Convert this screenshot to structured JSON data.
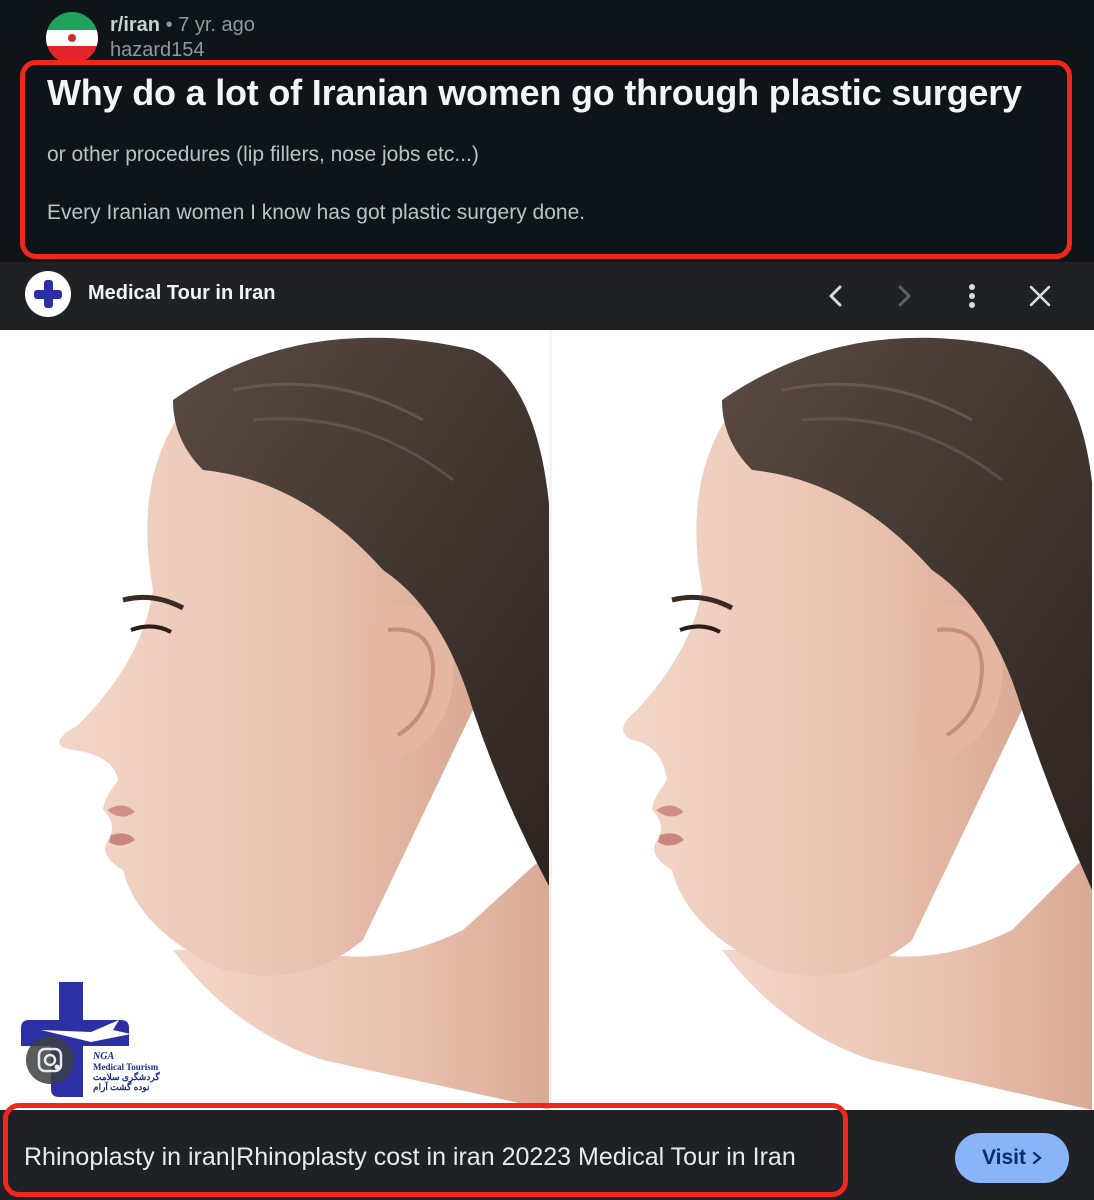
{
  "post": {
    "subreddit": "r/iran",
    "age": "7 yr. ago",
    "separator": "•",
    "author": "hazard154",
    "title": "Why do a lot of Iranian women go through plastic surgery",
    "body_lines": [
      "or other procedures (lip fillers, nose jobs etc...)",
      "Every Iranian women I know has got plastic surgery done."
    ]
  },
  "ad": {
    "advertiser": "Medical Tour in Iran",
    "icons": [
      "previous-icon",
      "next-icon",
      "more-vert-icon",
      "close-icon"
    ],
    "image": {
      "panels": [
        "before",
        "after"
      ],
      "logo_text": [
        "NGA",
        "Medical Tourism",
        "گردشگری سلامت",
        "نوده گشت آرام"
      ]
    },
    "caption": "Rhinoplasty in iran|Rhinoplasty cost in iran 20223 Medical Tour in Iran",
    "visit_label": "Visit"
  },
  "colors": {
    "highlight": "#f0271b",
    "visit_button": "#8ab4f8",
    "background": "#0e1417",
    "ad_bar": "#202124"
  }
}
